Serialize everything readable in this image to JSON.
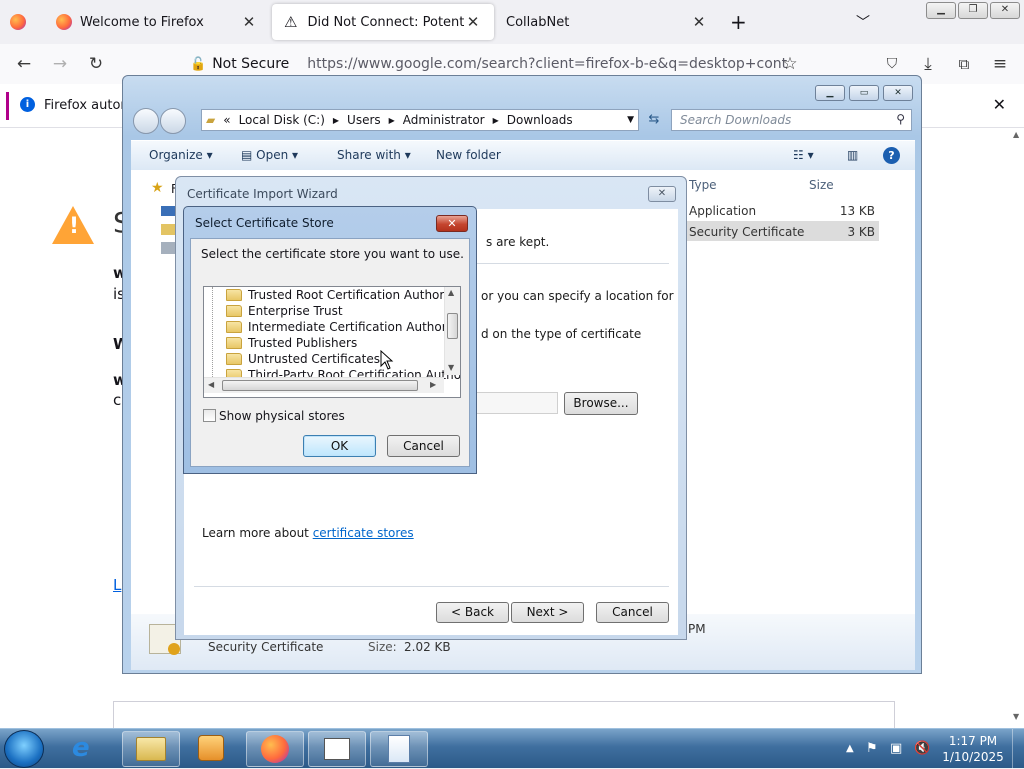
{
  "firefox": {
    "tabs": [
      {
        "title": "Welcome to Firefox"
      },
      {
        "title": "Did Not Connect: Potential Security Issue"
      },
      {
        "title": "CollabNet"
      }
    ],
    "new_tab_label": "+",
    "url_security": "Not Secure",
    "url": "https://www.google.com/search?client=firefox-b-e&q=desktop+context+menu",
    "notification": "Firefox automa",
    "page_fragments": {
      "heading_letter": "S",
      "w1": "w",
      "w2": "is",
      "w3": "W",
      "w4": "w",
      "w5": "c",
      "link": "L"
    }
  },
  "explorer": {
    "breadcrumb": [
      "Local Disk (C:)",
      "Users",
      "Administrator",
      "Downloads"
    ],
    "breadcrumb_prefix": "«",
    "search_placeholder": "Search Downloads",
    "toolbar": {
      "organize": "Organize",
      "open": "Open",
      "share_with": "Share with",
      "new_folder": "New folder"
    },
    "columns": {
      "type": "Type",
      "size": "Size"
    },
    "sidebar_first": "F",
    "rows": [
      {
        "type": "Application",
        "size": "13 KB"
      },
      {
        "type": "Security Certificate",
        "size": "3 KB"
      }
    ],
    "details": {
      "type": "Security Certificate",
      "size_label": "Size:",
      "size_value": "2.02 KB",
      "time_suffix": "PM"
    }
  },
  "wizard": {
    "title": "Certificate Import Wizard",
    "close": "✕",
    "text_kept": "s are kept.",
    "text_location": "or you can specify a location for",
    "text_type": "d on the type of certificate",
    "browse": "Browse...",
    "learn_more_prefix": "Learn more about ",
    "learn_more_link": "certificate stores",
    "back": "< Back",
    "next": "Next >",
    "cancel": "Cancel"
  },
  "store_dialog": {
    "title": "Select Certificate Store",
    "close": "✕",
    "prompt": "Select the certificate store you want to use.",
    "items": [
      "Trusted Root Certification Authorities",
      "Enterprise Trust",
      "Intermediate Certification Authorities",
      "Trusted Publishers",
      "Untrusted Certificates",
      "Third-Party Root Certification Authorities"
    ],
    "show_physical": "Show physical stores",
    "show_physical_checked": false,
    "ok": "OK",
    "cancel": "Cancel"
  },
  "taskbar": {
    "time": "1:17 PM",
    "date": "1/10/2025"
  }
}
